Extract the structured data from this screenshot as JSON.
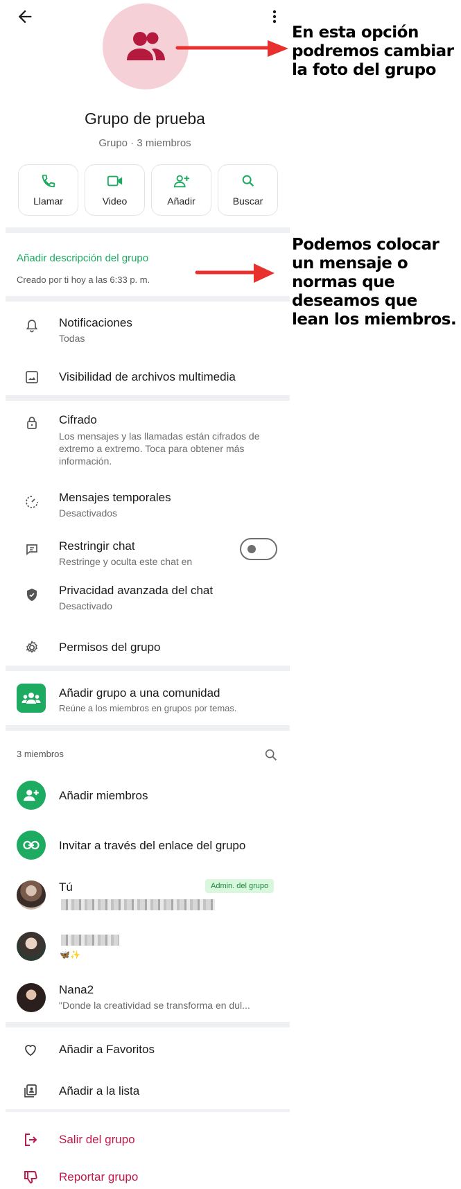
{
  "group": {
    "name": "Grupo de prueba",
    "subtitle": "Grupo · 3 miembros"
  },
  "actions": [
    {
      "label": "Llamar",
      "icon": "phone-icon"
    },
    {
      "label": "Video",
      "icon": "video-icon"
    },
    {
      "label": "Añadir",
      "icon": "add-person-icon"
    },
    {
      "label": "Buscar",
      "icon": "search-icon"
    }
  ],
  "description": {
    "link": "Añadir descripción del grupo",
    "created": "Creado por ti hoy a las 6:33 p. m."
  },
  "settings": {
    "notifications": {
      "title": "Notificaciones",
      "sub": "Todas"
    },
    "media": {
      "title": "Visibilidad de archivos multimedia"
    },
    "encryption": {
      "title": "Cifrado",
      "sub": "Los mensajes y las llamadas están cifrados de extremo a extremo. Toca para obtener más información."
    },
    "temporary": {
      "title": "Mensajes temporales",
      "sub": "Desactivados"
    },
    "restrict": {
      "title": "Restringir chat",
      "sub": "Restringe y oculta este chat en",
      "enabled": false
    },
    "privacy": {
      "title": "Privacidad avanzada del chat",
      "sub": "Desactivado"
    },
    "permissions": {
      "title": "Permisos del grupo"
    }
  },
  "community": {
    "title": "Añadir grupo a una comunidad",
    "sub": "Reúne a los miembros en grupos por temas."
  },
  "members": {
    "header": "3 miembros",
    "add": "Añadir miembros",
    "invite": "Invitar a través del enlace del grupo",
    "list": [
      {
        "name": "Tú",
        "badge": "Admin. del grupo"
      },
      {
        "name": "",
        "status": "🦋✨"
      },
      {
        "name": "Nana2",
        "status": "\"Donde la creatividad se transforma en dul..."
      }
    ]
  },
  "bottom": {
    "favorites": "Añadir a Favoritos",
    "list": "Añadir a la lista",
    "exit": "Salir del grupo",
    "report": "Reportar grupo"
  },
  "annotations": {
    "photo": "En esta opción podremos cambiar la foto del grupo",
    "description": "Podemos colocar un mensaje o normas que deseamos que lean los miembros."
  },
  "colors": {
    "accent_green": "#1daa61",
    "danger": "#c0184a",
    "avatar_bg": "#f5d0d6",
    "avatar_icon": "#b5193d",
    "arrow": "#e8312f"
  }
}
